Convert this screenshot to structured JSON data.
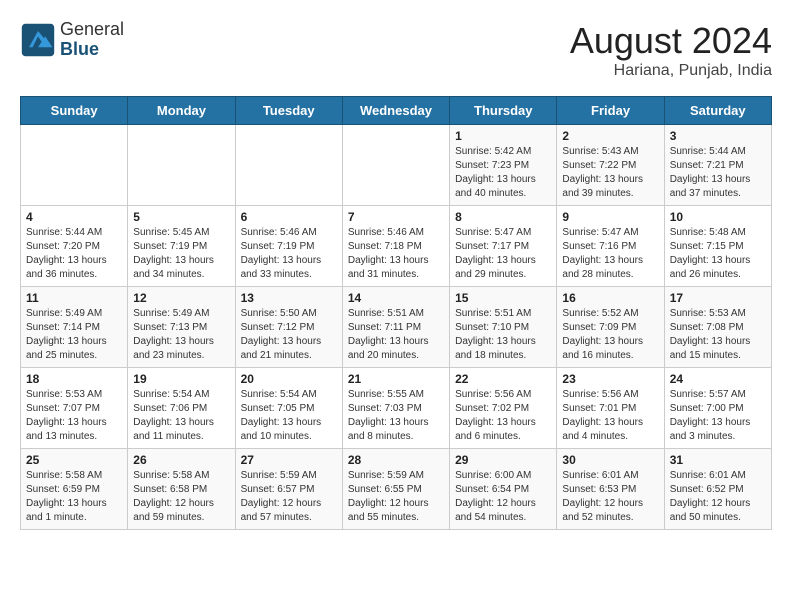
{
  "header": {
    "logo_general": "General",
    "logo_blue": "Blue",
    "month_year": "August 2024",
    "location": "Hariana, Punjab, India"
  },
  "weekdays": [
    "Sunday",
    "Monday",
    "Tuesday",
    "Wednesday",
    "Thursday",
    "Friday",
    "Saturday"
  ],
  "weeks": [
    [
      {
        "day": "",
        "sunrise": "",
        "sunset": "",
        "daylight": ""
      },
      {
        "day": "",
        "sunrise": "",
        "sunset": "",
        "daylight": ""
      },
      {
        "day": "",
        "sunrise": "",
        "sunset": "",
        "daylight": ""
      },
      {
        "day": "",
        "sunrise": "",
        "sunset": "",
        "daylight": ""
      },
      {
        "day": "1",
        "sunrise": "Sunrise: 5:42 AM",
        "sunset": "Sunset: 7:23 PM",
        "daylight": "Daylight: 13 hours and 40 minutes."
      },
      {
        "day": "2",
        "sunrise": "Sunrise: 5:43 AM",
        "sunset": "Sunset: 7:22 PM",
        "daylight": "Daylight: 13 hours and 39 minutes."
      },
      {
        "day": "3",
        "sunrise": "Sunrise: 5:44 AM",
        "sunset": "Sunset: 7:21 PM",
        "daylight": "Daylight: 13 hours and 37 minutes."
      }
    ],
    [
      {
        "day": "4",
        "sunrise": "Sunrise: 5:44 AM",
        "sunset": "Sunset: 7:20 PM",
        "daylight": "Daylight: 13 hours and 36 minutes."
      },
      {
        "day": "5",
        "sunrise": "Sunrise: 5:45 AM",
        "sunset": "Sunset: 7:19 PM",
        "daylight": "Daylight: 13 hours and 34 minutes."
      },
      {
        "day": "6",
        "sunrise": "Sunrise: 5:46 AM",
        "sunset": "Sunset: 7:19 PM",
        "daylight": "Daylight: 13 hours and 33 minutes."
      },
      {
        "day": "7",
        "sunrise": "Sunrise: 5:46 AM",
        "sunset": "Sunset: 7:18 PM",
        "daylight": "Daylight: 13 hours and 31 minutes."
      },
      {
        "day": "8",
        "sunrise": "Sunrise: 5:47 AM",
        "sunset": "Sunset: 7:17 PM",
        "daylight": "Daylight: 13 hours and 29 minutes."
      },
      {
        "day": "9",
        "sunrise": "Sunrise: 5:47 AM",
        "sunset": "Sunset: 7:16 PM",
        "daylight": "Daylight: 13 hours and 28 minutes."
      },
      {
        "day": "10",
        "sunrise": "Sunrise: 5:48 AM",
        "sunset": "Sunset: 7:15 PM",
        "daylight": "Daylight: 13 hours and 26 minutes."
      }
    ],
    [
      {
        "day": "11",
        "sunrise": "Sunrise: 5:49 AM",
        "sunset": "Sunset: 7:14 PM",
        "daylight": "Daylight: 13 hours and 25 minutes."
      },
      {
        "day": "12",
        "sunrise": "Sunrise: 5:49 AM",
        "sunset": "Sunset: 7:13 PM",
        "daylight": "Daylight: 13 hours and 23 minutes."
      },
      {
        "day": "13",
        "sunrise": "Sunrise: 5:50 AM",
        "sunset": "Sunset: 7:12 PM",
        "daylight": "Daylight: 13 hours and 21 minutes."
      },
      {
        "day": "14",
        "sunrise": "Sunrise: 5:51 AM",
        "sunset": "Sunset: 7:11 PM",
        "daylight": "Daylight: 13 hours and 20 minutes."
      },
      {
        "day": "15",
        "sunrise": "Sunrise: 5:51 AM",
        "sunset": "Sunset: 7:10 PM",
        "daylight": "Daylight: 13 hours and 18 minutes."
      },
      {
        "day": "16",
        "sunrise": "Sunrise: 5:52 AM",
        "sunset": "Sunset: 7:09 PM",
        "daylight": "Daylight: 13 hours and 16 minutes."
      },
      {
        "day": "17",
        "sunrise": "Sunrise: 5:53 AM",
        "sunset": "Sunset: 7:08 PM",
        "daylight": "Daylight: 13 hours and 15 minutes."
      }
    ],
    [
      {
        "day": "18",
        "sunrise": "Sunrise: 5:53 AM",
        "sunset": "Sunset: 7:07 PM",
        "daylight": "Daylight: 13 hours and 13 minutes."
      },
      {
        "day": "19",
        "sunrise": "Sunrise: 5:54 AM",
        "sunset": "Sunset: 7:06 PM",
        "daylight": "Daylight: 13 hours and 11 minutes."
      },
      {
        "day": "20",
        "sunrise": "Sunrise: 5:54 AM",
        "sunset": "Sunset: 7:05 PM",
        "daylight": "Daylight: 13 hours and 10 minutes."
      },
      {
        "day": "21",
        "sunrise": "Sunrise: 5:55 AM",
        "sunset": "Sunset: 7:03 PM",
        "daylight": "Daylight: 13 hours and 8 minutes."
      },
      {
        "day": "22",
        "sunrise": "Sunrise: 5:56 AM",
        "sunset": "Sunset: 7:02 PM",
        "daylight": "Daylight: 13 hours and 6 minutes."
      },
      {
        "day": "23",
        "sunrise": "Sunrise: 5:56 AM",
        "sunset": "Sunset: 7:01 PM",
        "daylight": "Daylight: 13 hours and 4 minutes."
      },
      {
        "day": "24",
        "sunrise": "Sunrise: 5:57 AM",
        "sunset": "Sunset: 7:00 PM",
        "daylight": "Daylight: 13 hours and 3 minutes."
      }
    ],
    [
      {
        "day": "25",
        "sunrise": "Sunrise: 5:58 AM",
        "sunset": "Sunset: 6:59 PM",
        "daylight": "Daylight: 13 hours and 1 minute."
      },
      {
        "day": "26",
        "sunrise": "Sunrise: 5:58 AM",
        "sunset": "Sunset: 6:58 PM",
        "daylight": "Daylight: 12 hours and 59 minutes."
      },
      {
        "day": "27",
        "sunrise": "Sunrise: 5:59 AM",
        "sunset": "Sunset: 6:57 PM",
        "daylight": "Daylight: 12 hours and 57 minutes."
      },
      {
        "day": "28",
        "sunrise": "Sunrise: 5:59 AM",
        "sunset": "Sunset: 6:55 PM",
        "daylight": "Daylight: 12 hours and 55 minutes."
      },
      {
        "day": "29",
        "sunrise": "Sunrise: 6:00 AM",
        "sunset": "Sunset: 6:54 PM",
        "daylight": "Daylight: 12 hours and 54 minutes."
      },
      {
        "day": "30",
        "sunrise": "Sunrise: 6:01 AM",
        "sunset": "Sunset: 6:53 PM",
        "daylight": "Daylight: 12 hours and 52 minutes."
      },
      {
        "day": "31",
        "sunrise": "Sunrise: 6:01 AM",
        "sunset": "Sunset: 6:52 PM",
        "daylight": "Daylight: 12 hours and 50 minutes."
      }
    ]
  ]
}
